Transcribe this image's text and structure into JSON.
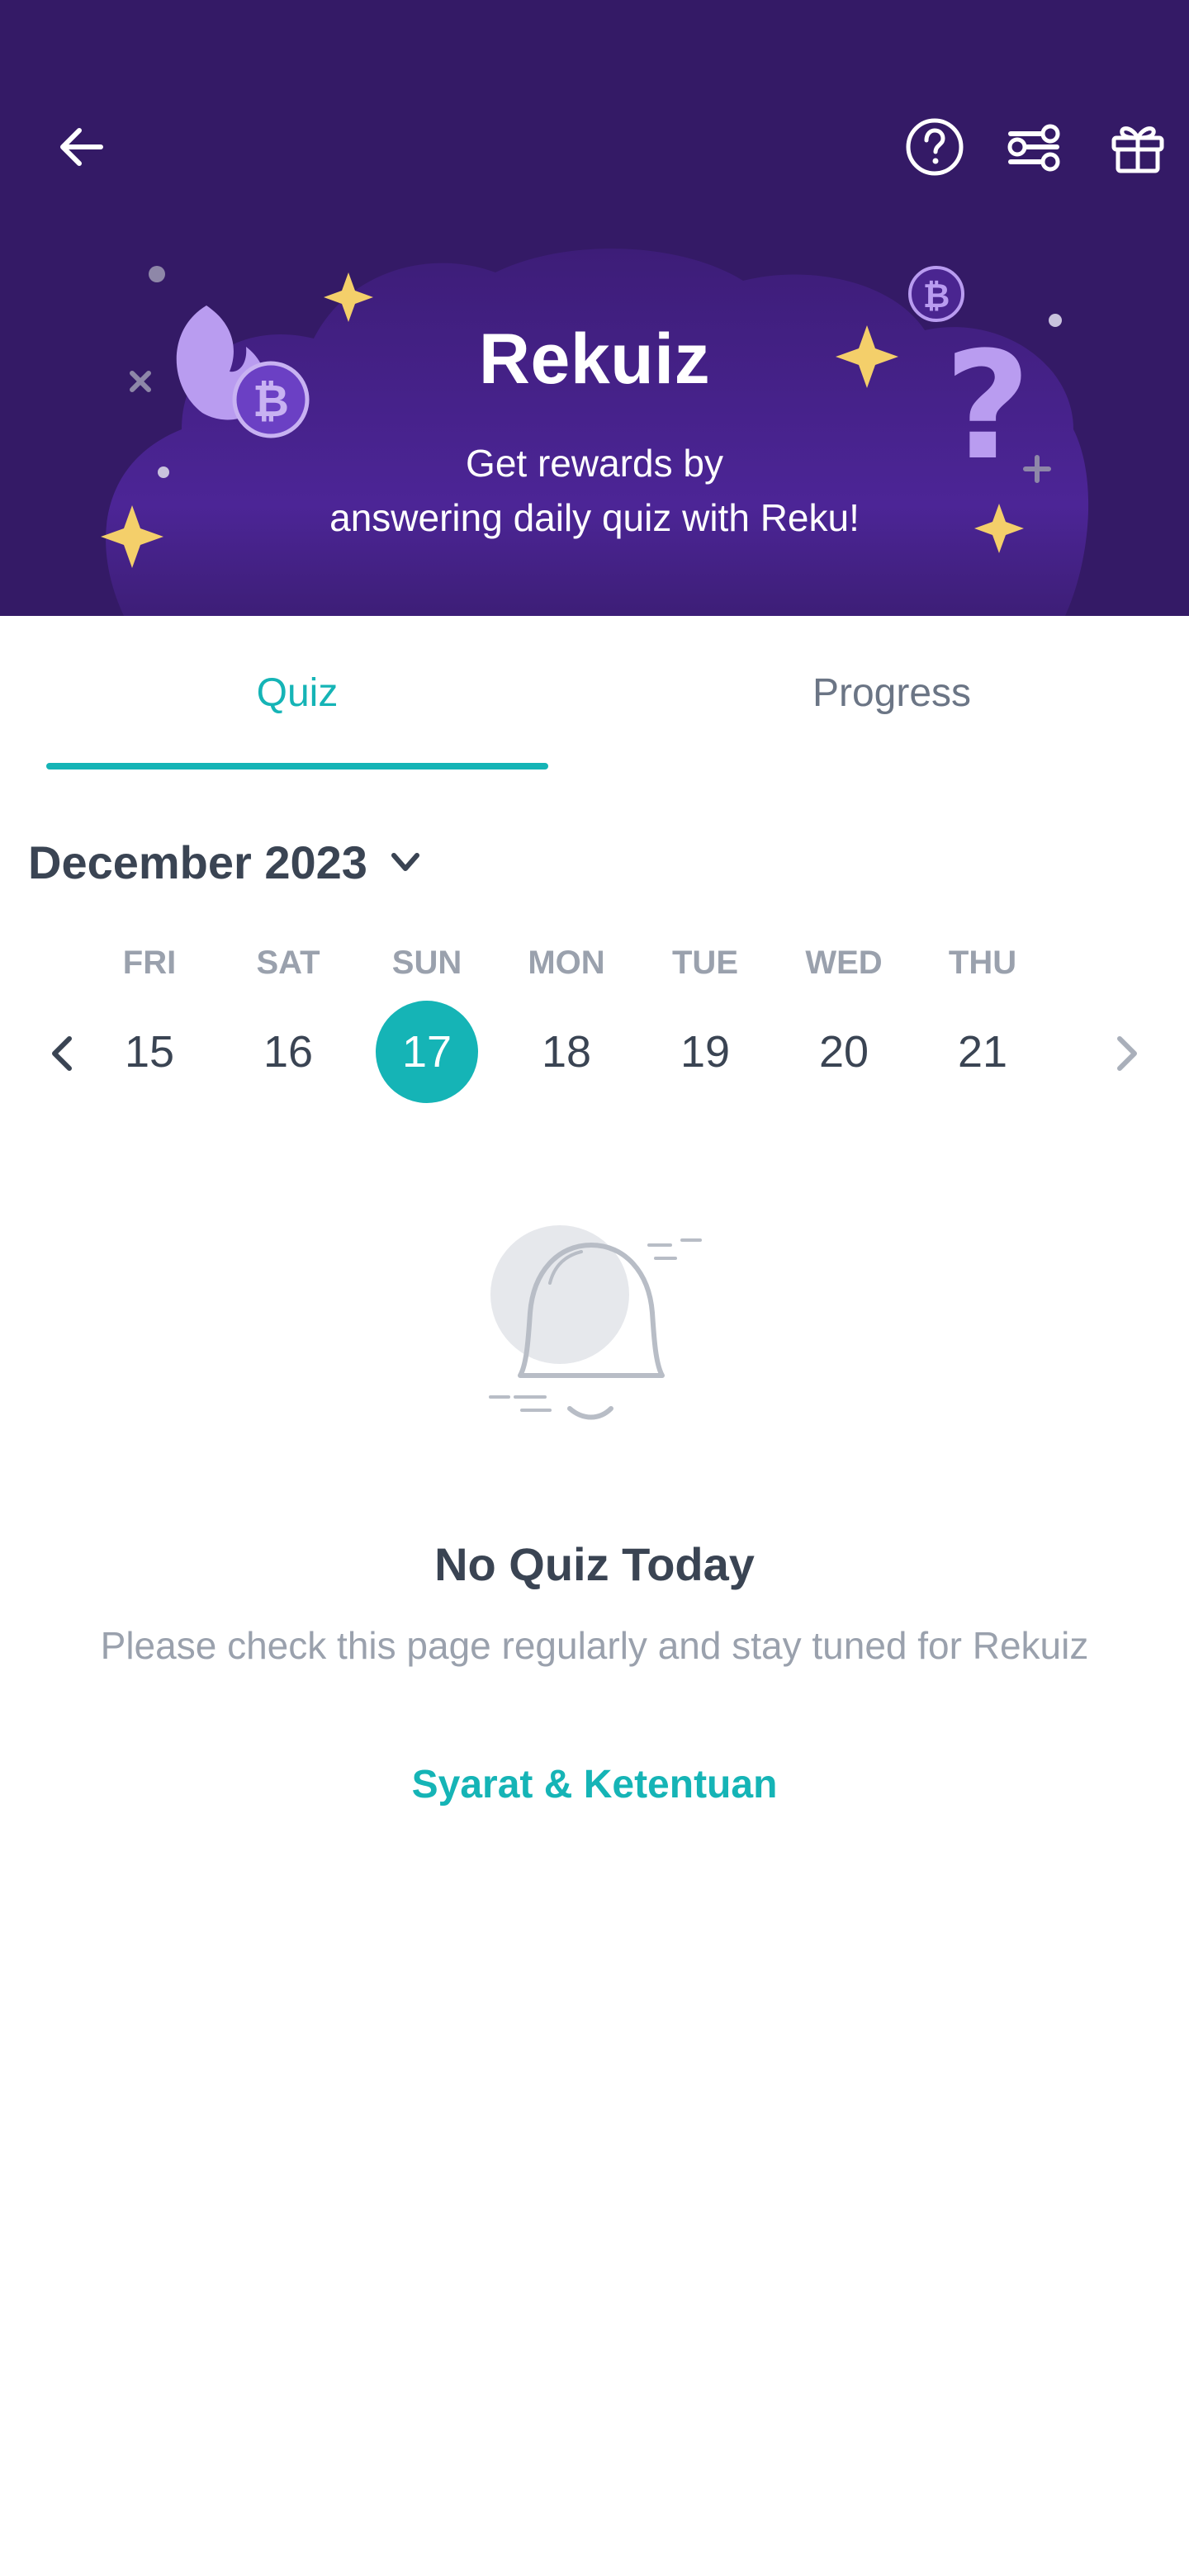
{
  "header": {
    "back_icon": "arrow-left-icon",
    "help_icon": "question-circle-icon",
    "settings_icon": "sliders-icon",
    "gift_icon": "gift-icon",
    "title": "Rekuiz",
    "subtitle_line1": "Get rewards by",
    "subtitle_line2": "answering daily quiz with Reku!",
    "colors": {
      "background": "#341a66",
      "cloud": "#4a2590",
      "sparkle": "#f4cf6a",
      "accent_purple": "#b99cf0"
    }
  },
  "tabs": [
    {
      "label": "Quiz",
      "active": true
    },
    {
      "label": "Progress",
      "active": false
    }
  ],
  "calendar": {
    "month_label": "December 2023",
    "days": [
      {
        "name": "FRI",
        "number": "15",
        "selected": false
      },
      {
        "name": "SAT",
        "number": "16",
        "selected": false
      },
      {
        "name": "SUN",
        "number": "17",
        "selected": true
      },
      {
        "name": "MON",
        "number": "18",
        "selected": false
      },
      {
        "name": "TUE",
        "number": "19",
        "selected": false
      },
      {
        "name": "WED",
        "number": "20",
        "selected": false
      },
      {
        "name": "THU",
        "number": "21",
        "selected": false
      }
    ]
  },
  "empty_state": {
    "icon": "bell-icon",
    "title": "No Quiz Today",
    "description": "Please check this page regularly and stay tuned for Rekuiz"
  },
  "footer": {
    "terms_link": "Syarat & Ketentuan"
  },
  "colors": {
    "accent": "#15b4b6",
    "text_primary": "#3a4453",
    "text_muted": "#9aa1ad"
  }
}
